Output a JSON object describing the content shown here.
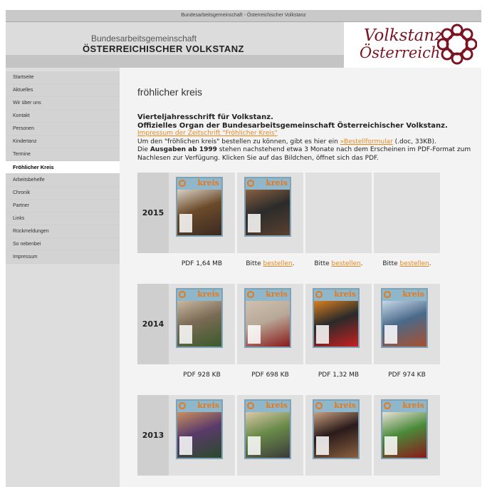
{
  "window": {
    "title": "Bundesarbeitsgemeinschaft - Österreichischer Volkstanz"
  },
  "header": {
    "line1": "Bundesarbeitsgemeinschaft",
    "line2": "ÖSTERREICHISCHER VOLKSTANZ",
    "logo_line1": "Volkstanz",
    "logo_line2": "Österreich"
  },
  "sidebar": {
    "items": [
      {
        "label": "Startseite",
        "active": false
      },
      {
        "label": "Aktuelles",
        "active": false
      },
      {
        "label": "Wir über uns",
        "active": false
      },
      {
        "label": "Kontakt",
        "active": false
      },
      {
        "label": "Personen",
        "active": false
      },
      {
        "label": "Kindertanz",
        "active": false
      },
      {
        "label": "Termine",
        "active": false
      },
      {
        "label": "Fröhlicher Kreis",
        "active": true
      },
      {
        "label": "Arbeitsbehelfe",
        "active": false
      },
      {
        "label": "Chronik",
        "active": false
      },
      {
        "label": "Partner",
        "active": false
      },
      {
        "label": "Links",
        "active": false
      },
      {
        "label": "Rückmeldungen",
        "active": false
      },
      {
        "label": "So nebenbei",
        "active": false
      },
      {
        "label": "Impressum",
        "active": false
      }
    ]
  },
  "main": {
    "title": "fröhlicher kreis",
    "subtitle1": "Vierteljahresschrift für Volkstanz.",
    "subtitle2": "Offizielles Organ der Bundesarbeitsgemeinschaft Österreichischer Volkstanz.",
    "impressum_link": "Impressum der Zeitschrift \"Fröhlicher Kreis\"",
    "order_text_before": "Um den \"fröhlichen kreis\" bestellen zu können, gibt es hier ein ",
    "order_link": "»Bestellformular",
    "order_text_after": " (.doc, 33KB).",
    "archive_text_1": "Die ",
    "archive_bold": "Ausgaben ab 1999",
    "archive_text_2": "  stehen nachstehend etwa 3 Monate nach dem Erscheinen im PDF-Format zum Nachlesen zur Verfügung. Klicken Sie auf das Bildchen, öffnet sich das PDF.",
    "cover_title": "kreis"
  },
  "years": [
    {
      "year": "2015",
      "issues": [
        {
          "has_cover": true,
          "caption": "PDF 1,64 MB",
          "link": ""
        },
        {
          "has_cover": true,
          "caption": "Bitte ",
          "link": "bestellen"
        },
        {
          "has_cover": false,
          "caption": "Bitte ",
          "link": "bestellen"
        },
        {
          "has_cover": false,
          "caption": "Bitte ",
          "link": "bestellen"
        }
      ]
    },
    {
      "year": "2014",
      "issues": [
        {
          "has_cover": true,
          "caption": "PDF 928 KB",
          "link": ""
        },
        {
          "has_cover": true,
          "caption": "PDF 698 KB",
          "link": ""
        },
        {
          "has_cover": true,
          "caption": "PDF 1,32 MB",
          "link": ""
        },
        {
          "has_cover": true,
          "caption": "PDF 974 KB",
          "link": ""
        }
      ]
    },
    {
      "year": "2013",
      "issues": [
        {
          "has_cover": true,
          "caption": "",
          "link": ""
        },
        {
          "has_cover": true,
          "caption": "",
          "link": ""
        },
        {
          "has_cover": true,
          "caption": "",
          "link": ""
        },
        {
          "has_cover": true,
          "caption": "",
          "link": ""
        }
      ]
    }
  ],
  "colors": {
    "accent": "#e8891e",
    "logo": "#7b1420",
    "cover_frame": "#7fa2b7"
  }
}
